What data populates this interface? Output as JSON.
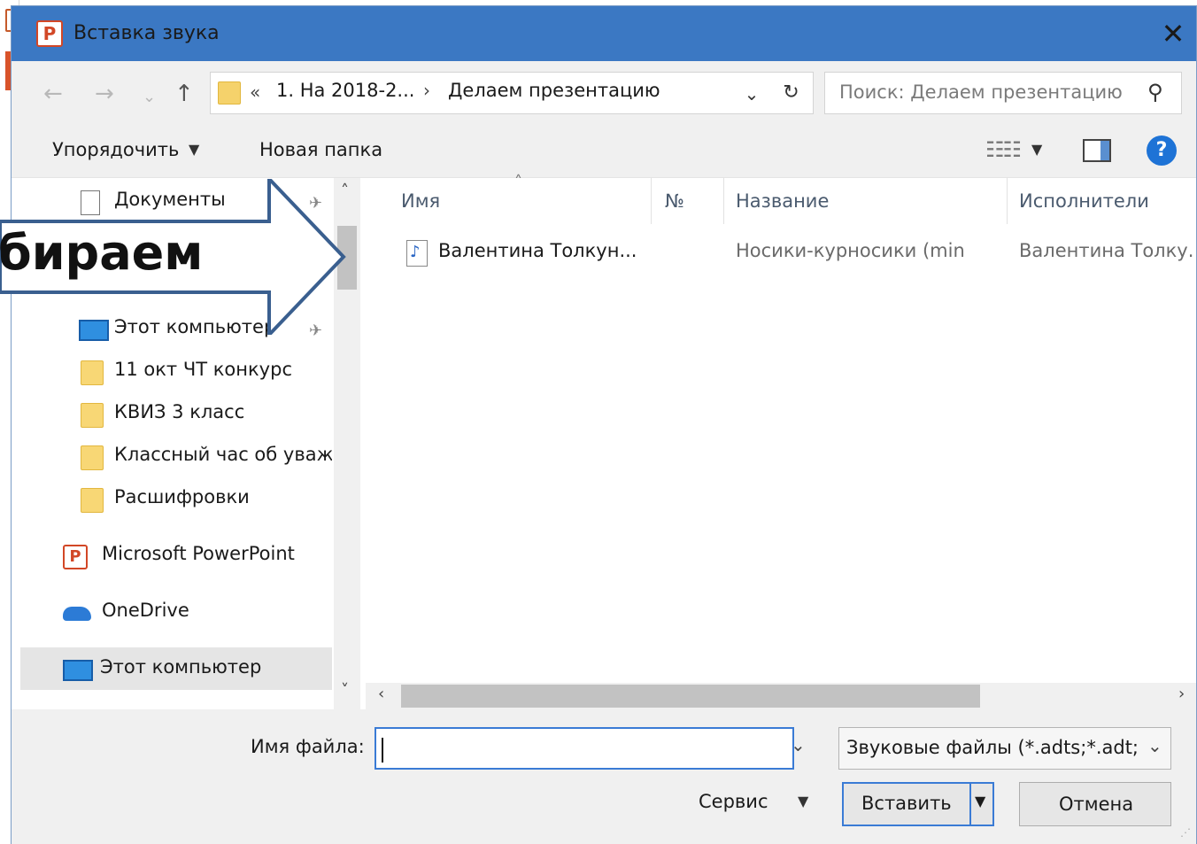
{
  "window": {
    "title": "Вставка звука",
    "app_icon_letter": "P",
    "close_glyph": "✕",
    "accent": "#3b78c3"
  },
  "nav": {
    "back_glyph": "←",
    "forward_glyph": "→",
    "recent_glyph": "⌄",
    "up_glyph": "↑",
    "breadcrumb_chevron": "«",
    "breadcrumb": [
      "1. На 2018-2...",
      "Делаем презентацию"
    ],
    "breadcrumb_sep": "›",
    "dropdown_glyph": "⌄",
    "refresh_glyph": "↻",
    "search_placeholder": "Поиск: Делаем презентацию",
    "search_glyph": "⚲"
  },
  "toolbar": {
    "organize_label": "Упорядочить",
    "organize_arrow": "▼",
    "new_folder_label": "Новая папка",
    "view_glyph": "☷☷",
    "view_arrow": "▼",
    "help_glyph": "?"
  },
  "sidebar": {
    "items": [
      {
        "label": "Документы",
        "icon": "document-icon"
      },
      {
        "label": "Этот компьютер",
        "icon": "computer-icon"
      },
      {
        "label": "11 окт ЧТ конкурс",
        "icon": "folder-icon"
      },
      {
        "label": "КВИЗ 3 класс",
        "icon": "folder-icon"
      },
      {
        "label": "Классный час об уваж",
        "icon": "folder-icon"
      },
      {
        "label": "Расшифровки",
        "icon": "folder-icon"
      },
      {
        "label": "Microsoft PowerPoint",
        "icon": "powerpoint-icon"
      },
      {
        "label": "OneDrive",
        "icon": "onedrive-icon"
      },
      {
        "label": "Этот компьютер",
        "icon": "computer-icon"
      }
    ],
    "pin_glyph": "✈",
    "scroll_up": "˄",
    "scroll_down": "˅"
  },
  "filelist": {
    "columns": [
      "Имя",
      "№",
      "Название",
      "Исполнители"
    ],
    "sort_caret": "˄",
    "rows": [
      {
        "name": "Валентина Толкун...",
        "number": "",
        "title": "Носики-курносики (min",
        "artists": "Валентина Толку..",
        "icon": "audio-file-icon"
      }
    ],
    "scroll_left": "‹",
    "scroll_right": "›"
  },
  "footer": {
    "filename_label": "Имя файла:",
    "filename_value": "",
    "filename_dropdown": "⌄",
    "filetype_value": "Звуковые файлы (*.adts;*.adt;'",
    "filetype_dropdown": "⌄",
    "tools_label": "Сервис",
    "tools_arrow": "▼",
    "insert_label": "Вставить",
    "insert_arrow": "▼",
    "cancel_label": "Отмена",
    "grip_glyph": "⋰"
  },
  "overlay": {
    "callout_text": "бираем",
    "arrow_color": "#3a5f8f"
  }
}
